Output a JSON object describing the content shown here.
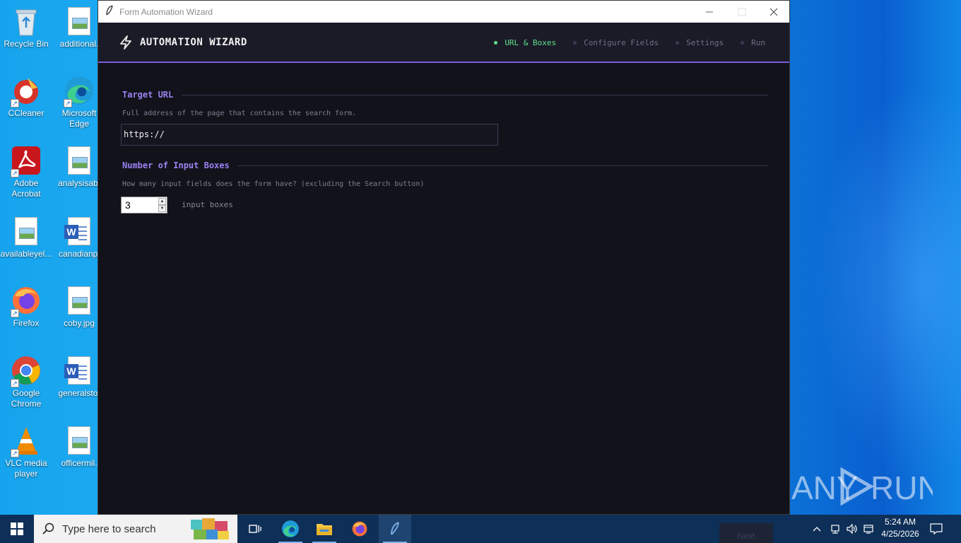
{
  "desktop": {
    "icons": [
      {
        "label": "Recycle Bin"
      },
      {
        "label": "additional."
      },
      {
        "label": "CCleaner"
      },
      {
        "label": "Microsoft Edge"
      },
      {
        "label": "Adobe Acrobat"
      },
      {
        "label": "analysisab."
      },
      {
        "label": "availableyel..."
      },
      {
        "label": "canadianpi"
      },
      {
        "label": "Firefox"
      },
      {
        "label": "coby.jpg"
      },
      {
        "label": "Google Chrome"
      },
      {
        "label": "generalsto."
      },
      {
        "label": "VLC media player"
      },
      {
        "label": "officermil."
      }
    ],
    "watermark": "ANY RUN"
  },
  "window": {
    "title": "Form Automation Wizard",
    "app_title": "AUTOMATION WIZARD",
    "steps": [
      {
        "label": "URL & Boxes",
        "active": true
      },
      {
        "label": "Configure Fields",
        "active": false
      },
      {
        "label": "Settings",
        "active": false
      },
      {
        "label": "Run",
        "active": false
      }
    ],
    "url_section": {
      "title": "Target URL",
      "help": "Full address of the page that contains the search form.",
      "value": "https://"
    },
    "boxes_section": {
      "title": "Number of Input Boxes",
      "help": "How many input fields does the form have? (excluding the Search button)",
      "count": "3",
      "suffix": "input boxes"
    },
    "next_button": "Next"
  },
  "taskbar": {
    "search_placeholder": "Type here to search",
    "time": "5:24 AM",
    "date": "4/25/2026"
  },
  "colors": {
    "accent_purple": "#7c5ad8",
    "step_active": "#5fe08a",
    "window_bg": "#12121b"
  }
}
